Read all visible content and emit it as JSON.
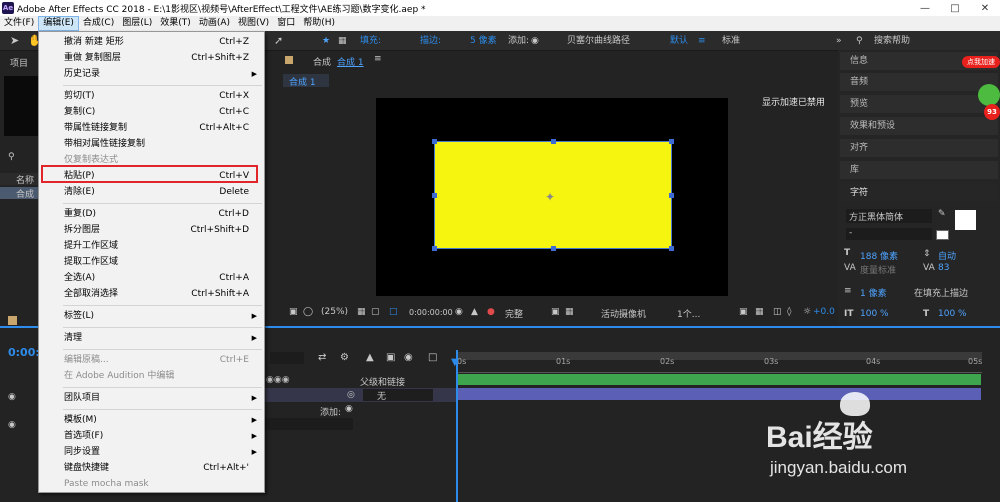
{
  "window": {
    "title": "Adobe After Effects CC 2018 - E:\\1影视区\\视频号\\AfterEffect\\工程文件\\AE练习题\\数字变化.aep *",
    "logo": "Ae"
  },
  "menubar": [
    "文件(F)",
    "编辑(E)",
    "合成(C)",
    "图层(L)",
    "效果(T)",
    "动画(A)",
    "视图(V)",
    "窗口",
    "帮助(H)"
  ],
  "toolbar": {
    "fill_label": "填充:",
    "stroke_label": "描边:",
    "stroke_px": "5 像素",
    "add_label": "添加:",
    "bezier_label": "贝塞尔曲线路径",
    "default_label": "默认",
    "standard_label": "标准",
    "search_placeholder": "搜索帮助"
  },
  "left_panel": {
    "project_tab": "项目",
    "name_header": "名称",
    "item_label": "合成"
  },
  "comp_panel": {
    "header_label": "合成",
    "comp_name": "合成 1",
    "sub_tab": "合成 1",
    "accel_notice": "显示加速已禁用"
  },
  "comp_footer": {
    "zoom": "(25%)",
    "timecode": "0:00:00:00",
    "quality": "完整",
    "camera": "活动摄像机",
    "views": "1个...",
    "exposure": "+0.0"
  },
  "right_panel": {
    "items": [
      "信息",
      "音频",
      "预览",
      "效果和预设",
      "对齐",
      "库"
    ],
    "char_title": "字符",
    "font_name": "方正黑体简体",
    "font_style": "-",
    "font_size": "188 像素",
    "leading": "自动",
    "kerning": "度量标准",
    "tracking": "83",
    "stroke_width": "1 像素",
    "stroke_mode": "在填充上描边",
    "vscale": "100 %",
    "hscale": "100 %",
    "badge": "点我加速",
    "badge_num": "93"
  },
  "timeline": {
    "timecode": "0:00:",
    "parent_label": "父级和链接",
    "parent_value": "无",
    "add_label": "添加:",
    "ruler": [
      "0s",
      "01s",
      "02s",
      "03s",
      "04s",
      "05s"
    ]
  },
  "edit_menu": {
    "items": [
      {
        "label": "撤消 新建 矩形",
        "shortcut": "Ctrl+Z"
      },
      {
        "label": "重做 复制图层",
        "shortcut": "Ctrl+Shift+Z"
      },
      {
        "label": "历史记录",
        "shortcut": ""
      },
      {
        "label": "剪切(T)",
        "shortcut": "Ctrl+X"
      },
      {
        "label": "复制(C)",
        "shortcut": "Ctrl+C"
      },
      {
        "label": "带属性链接复制",
        "shortcut": "Ctrl+Alt+C"
      },
      {
        "label": "带相对属性链接复制",
        "shortcut": ""
      },
      {
        "label": "仅复制表达式",
        "shortcut": ""
      },
      {
        "label": "粘贴(P)",
        "shortcut": "Ctrl+V"
      },
      {
        "label": "清除(E)",
        "shortcut": "Delete"
      },
      {
        "label": "重复(D)",
        "shortcut": "Ctrl+D"
      },
      {
        "label": "拆分图层",
        "shortcut": "Ctrl+Shift+D"
      },
      {
        "label": "提升工作区域",
        "shortcut": ""
      },
      {
        "label": "提取工作区域",
        "shortcut": ""
      },
      {
        "label": "全选(A)",
        "shortcut": "Ctrl+A"
      },
      {
        "label": "全部取消选择",
        "shortcut": "Ctrl+Shift+A"
      },
      {
        "label": "标签(L)",
        "shortcut": ""
      },
      {
        "label": "清理",
        "shortcut": ""
      },
      {
        "label": "编辑原稿...",
        "shortcut": "Ctrl+E"
      },
      {
        "label": "在 Adobe Audition 中编辑",
        "shortcut": ""
      },
      {
        "label": "团队项目",
        "shortcut": ""
      },
      {
        "label": "模板(M)",
        "shortcut": ""
      },
      {
        "label": "首选项(F)",
        "shortcut": ""
      },
      {
        "label": "同步设置",
        "shortcut": ""
      },
      {
        "label": "键盘快捷键",
        "shortcut": "Ctrl+Alt+'"
      },
      {
        "label": "Paste mocha mask",
        "shortcut": ""
      }
    ]
  },
  "watermark": {
    "brand": "Bai经验",
    "url": "jingyan.baidu.com"
  },
  "colors": {
    "shape_fill": "#f5f50f",
    "accent_blue": "#2d8ceb",
    "highlight_red": "#e0262a"
  }
}
